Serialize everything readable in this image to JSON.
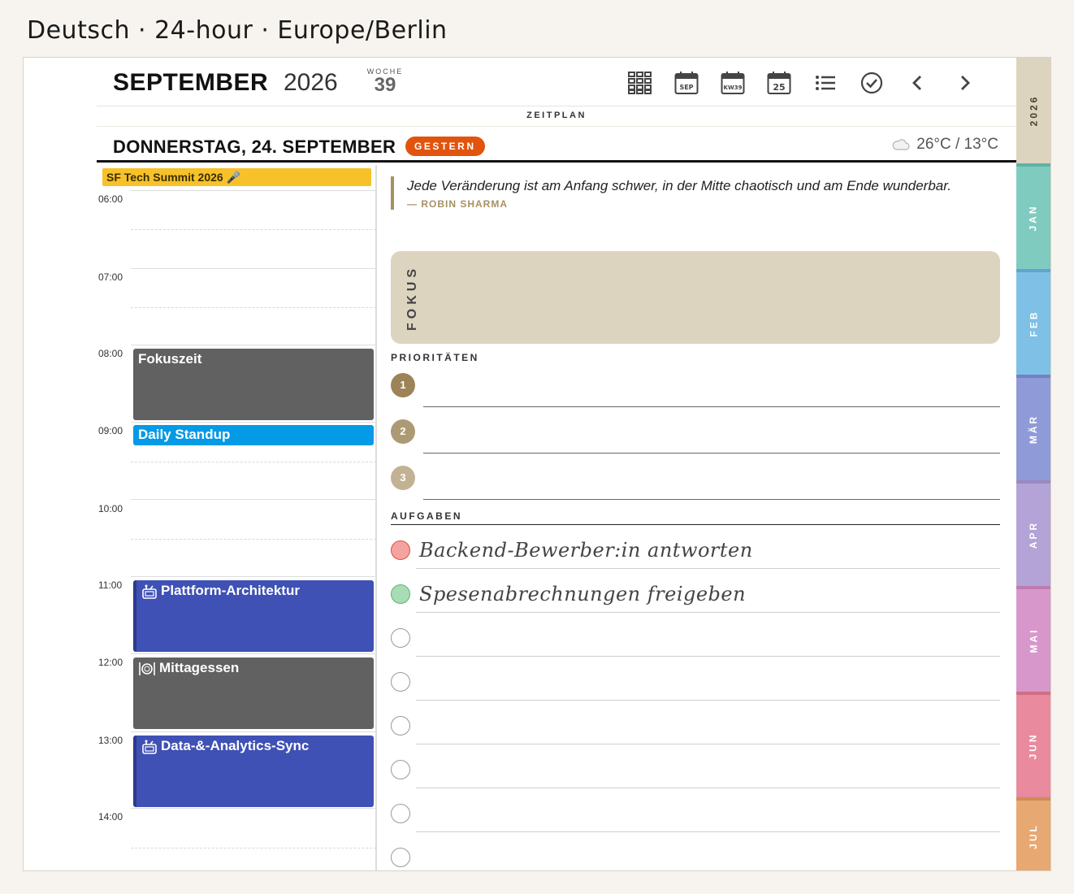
{
  "locale_caption": "Deutsch · 24-hour · Europe/Berlin",
  "header": {
    "month": "SEPTEMBER",
    "year": "2026",
    "week_label": "WOCHE",
    "week_number": "39",
    "toolbar_icons": [
      "year-grid-icon",
      "month-calendar-icon",
      "week-calendar-icon",
      "day-calendar-icon",
      "list-icon",
      "check-circle-icon",
      "chevron-left-icon",
      "chevron-right-icon"
    ],
    "month_icon_text": "SEP",
    "week_icon_text": "KW39",
    "day_icon_text": "25"
  },
  "section_title": "ZEITPLAN",
  "day": {
    "title": "DONNERSTAG, 24. SEPTEMBER",
    "badge": "GESTERN",
    "badge_color": "#e2540e",
    "weather_icon": "cloud-icon",
    "weather": "26°C / 13°C"
  },
  "timeline": {
    "all_day_event": "SF Tech Summit 2026 🎤",
    "hours": [
      "06:00",
      "07:00",
      "08:00",
      "09:00",
      "10:00",
      "11:00",
      "12:00",
      "13:00",
      "14:00"
    ],
    "events": [
      {
        "title": "Fokuszeit",
        "icon": "",
        "color": "#616161"
      },
      {
        "title": "Daily Standup",
        "icon": "",
        "color": "#049ae5"
      },
      {
        "title": "Plattform-Architektur",
        "icon": "meeting-icon",
        "color": "#3f51b5"
      },
      {
        "title": "Mittagessen",
        "icon": "meal-icon",
        "color": "#616161"
      },
      {
        "title": "Data-&-Analytics-Sync",
        "icon": "meeting-icon",
        "color": "#3f51b5"
      }
    ]
  },
  "quote": {
    "text": "Jede Veränderung ist am Anfang schwer, in der Mitte chaotisch und am Ende wunderbar.",
    "author": "— ROBIN SHARMA"
  },
  "focus_label": "FOKUS",
  "priorities": {
    "label": "PRIORITÄTEN",
    "items": [
      "1",
      "2",
      "3"
    ]
  },
  "tasks": {
    "label": "AUFGABEN",
    "items": [
      {
        "text": "Backend-Bewerber:in antworten",
        "status_color": "#f4a3a0"
      },
      {
        "text": "Spesenabrechnungen freigeben",
        "status_color": "#a8dcb5"
      },
      {
        "text": "",
        "status_color": ""
      },
      {
        "text": "",
        "status_color": ""
      },
      {
        "text": "",
        "status_color": ""
      },
      {
        "text": "",
        "status_color": ""
      },
      {
        "text": "",
        "status_color": ""
      },
      {
        "text": "",
        "status_color": ""
      }
    ]
  },
  "tabs": [
    {
      "label": "2026",
      "color": "#dcd4bf"
    },
    {
      "label": "JAN",
      "color": "#7fcbbf"
    },
    {
      "label": "FEB",
      "color": "#7fc0e6"
    },
    {
      "label": "MÄR",
      "color": "#8f9bd9"
    },
    {
      "label": "APR",
      "color": "#b4a3d6"
    },
    {
      "label": "MAI",
      "color": "#d897cb"
    },
    {
      "label": "JUN",
      "color": "#e98a9e"
    },
    {
      "label": "JUL",
      "color": "#e8a872"
    }
  ]
}
